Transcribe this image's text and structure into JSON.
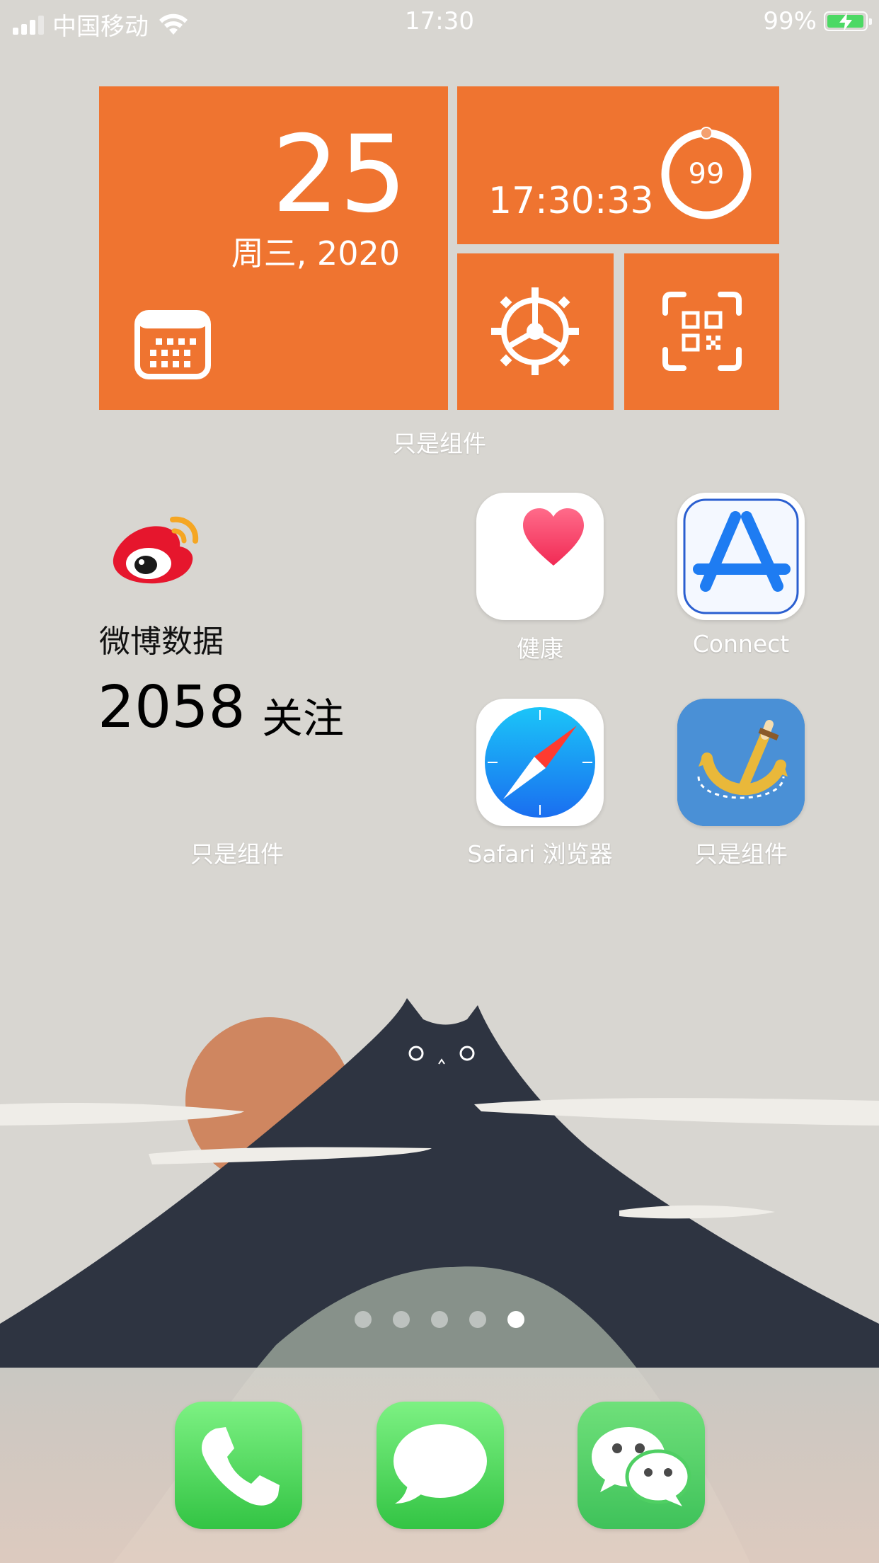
{
  "status_bar": {
    "carrier": "中国移动",
    "time": "17:30",
    "battery_percent": "99%",
    "battery_level": 0.99
  },
  "widget_top": {
    "date_day": "25",
    "date_line": "周三, 2020",
    "clock": "17:30:33",
    "battery_ring_value": "99",
    "label": "只是组件"
  },
  "weibo_widget": {
    "title": "微博数据",
    "count": "2058",
    "count_label": "关注",
    "label": "只是组件"
  },
  "apps": [
    {
      "name": "健康",
      "icon": "health-heart-icon"
    },
    {
      "name": "Connect",
      "icon": "app-store-connect-icon"
    },
    {
      "name": "Safari 浏览器",
      "icon": "safari-compass-icon"
    },
    {
      "name": "只是组件",
      "icon": "anchor-icon"
    }
  ],
  "page_dots": {
    "count": 5,
    "active": 5
  },
  "dock": [
    {
      "name": "phone",
      "icon": "phone-icon"
    },
    {
      "name": "messages",
      "icon": "messages-icon"
    },
    {
      "name": "wechat",
      "icon": "wechat-icon"
    }
  ],
  "colors": {
    "accent_orange": "#ef7430",
    "wallpaper": "#d7d5d0",
    "mountain": "#2e3441",
    "sun": "#cf8660"
  }
}
